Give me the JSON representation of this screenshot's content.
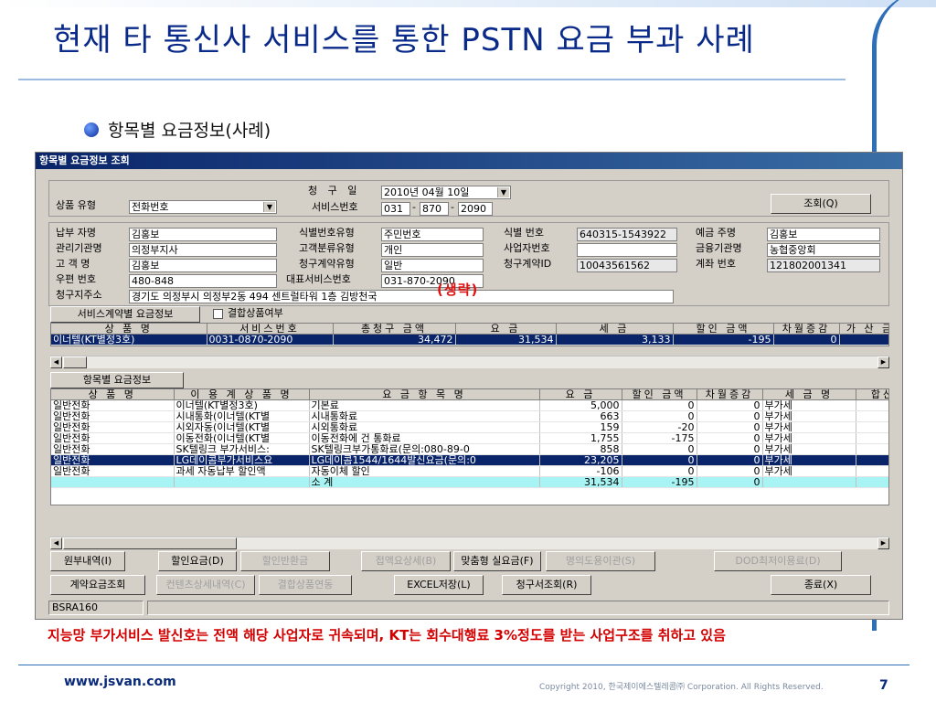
{
  "slide": {
    "title": "현재 타 통신사 서비스를 통한  PSTN 요금 부과 사례",
    "bullet": "항목별 요금정보(사례)",
    "caption": "지능망 부가서비스 발신호는 전액 해당 사업자로 귀속되며, KT는 회수대행료 3%정도를 받는 사업구조를 취하고 있음",
    "footer_url": "www.jsvan.com",
    "copyright": "Copyright 2010, 한국제이에스텔레콤㈜ Corporation. All Rights Reserved.",
    "page_number": "7",
    "annotation": "(생략)",
    "colors": {
      "title": "#0a2a8a",
      "caption": "#d40000",
      "selected_row": "#0a246a",
      "subtotal_row": "#a8f4f4"
    }
  },
  "window": {
    "title": "항목별 요금정보 조회",
    "top": {
      "bill_month_label": "청 구 일",
      "bill_month_value": "2010년 04월 10일",
      "service_no_label": "서비스번호",
      "service_no_1": "031",
      "service_no_2": "870",
      "service_no_3": "2090",
      "product_type_label": "상품 유형",
      "product_type_value": "전화번호",
      "query_button": "조회(Q)",
      "separator": "-"
    },
    "info": {
      "payer_label": "납부 자명",
      "payer_value": "김홍보",
      "id_type_label": "식별번호유형",
      "id_type_value": "주민번호",
      "id_no_label": "식별 번호",
      "id_no_value": "640315-1543922",
      "depositor_label": "예금 주명",
      "depositor_value": "김홍보",
      "org_label": "관리기관명",
      "org_value": "의정부지사",
      "cust_class_label": "고객분류유형",
      "cust_class_value": "개인",
      "biz_no_label": "사업자번호",
      "biz_no_value": "",
      "bank_label": "금융기관명",
      "bank_value": "농협중앙회",
      "cust_label": "고 객 명",
      "cust_value": "김홍보",
      "contract_type_label": "청구계약유형",
      "contract_type_value": "일반",
      "contract_id_label": "청구계약ID",
      "contract_id_value": "10043561562",
      "account_label": "계좌 번호",
      "account_value": "121802001341",
      "zip_label": "우편 번호",
      "zip_value": "480-848",
      "rep_no_label": "대표서비스번호",
      "rep_no_value": "031-870-2090",
      "addr_label": "청구지주소",
      "addr_value": "경기도 의정부시 의정부2동 494 센트럴타워 1층 김방천국"
    },
    "service_section": {
      "tab_label": "서비스계약별 요금정보",
      "checkbox_label": "결합상품여부",
      "columns": [
        "상 품 명",
        "서비스번호",
        "총청구 금액",
        "요 금",
        "세 금",
        "할인 금액",
        "차월증감",
        "가 산 금"
      ],
      "rows": [
        [
          "이너텔(KT별정3호)",
          "0031-0870-2090",
          "34,472",
          "31,534",
          "3,133",
          "-195",
          "0",
          ""
        ]
      ]
    },
    "item_section": {
      "tab_label": "항목별 요금정보",
      "columns": [
        "상 품 명",
        "이 용 계 상 품 명",
        "요 금 항 목 명",
        "요 금",
        "할인 금액",
        "차월증감",
        "세 금 명",
        "합산"
      ],
      "rows": [
        [
          "일반전화",
          "이너텔(KT별정3호)",
          "기본료",
          "5,000",
          "0",
          "0",
          "부가세",
          ""
        ],
        [
          "일반전화",
          "시내통화(이너텔(KT별",
          "시내통화료",
          "663",
          "0",
          "0",
          "부가세",
          ""
        ],
        [
          "일반전화",
          "시외자동(이너텔(KT별",
          "시외통화료",
          "159",
          "-20",
          "0",
          "부가세",
          ""
        ],
        [
          "일반전화",
          "이동전화(이너텔(KT별",
          "이동전화에 건 통화료",
          "1,755",
          "-175",
          "0",
          "부가세",
          ""
        ],
        [
          "일반전화",
          "SK텔링크 부가서비스:",
          "SK텔링크부가통화료(문의:080-89-0",
          "858",
          "0",
          "0",
          "부가세",
          ""
        ],
        [
          "일반전화",
          "LG데이콤부가서비스요",
          "LG데이콤1544/1644발신요금(문의:0",
          "23,205",
          "0",
          "0",
          "부가세",
          ""
        ],
        [
          "일반전화",
          "과세 자동납부 할인액",
          "자동이체 할인",
          "-106",
          "0",
          "0",
          "부가세",
          ""
        ],
        [
          "",
          "",
          "소 계",
          "31,534",
          "-195",
          "0",
          "",
          ""
        ]
      ],
      "selected_row": 5,
      "subtotal_row": 7
    },
    "buttons_row1": [
      {
        "label": "원부내역(I)",
        "enabled": true
      },
      {
        "label": "할인요금(D)",
        "enabled": true
      },
      {
        "label": "할인반환금",
        "enabled": false
      },
      {
        "label": "접액요상세(B)",
        "enabled": false
      },
      {
        "label": "맞춤형 실요금(F)",
        "enabled": true
      },
      {
        "label": "명의도용이관(S)",
        "enabled": false
      },
      {
        "label": "DOD최저이용료(D)",
        "enabled": false
      }
    ],
    "buttons_row2": [
      {
        "label": "계약요금조회",
        "enabled": true
      },
      {
        "label": "컨텐츠상세내역(C)",
        "enabled": false
      },
      {
        "label": "결합상품연동",
        "enabled": false
      },
      {
        "label": "EXCEL저장(L)",
        "enabled": true
      },
      {
        "label": "청구서조회(R)",
        "enabled": true
      }
    ],
    "close_button": "종료(X)",
    "status_code": "BSRA160"
  }
}
